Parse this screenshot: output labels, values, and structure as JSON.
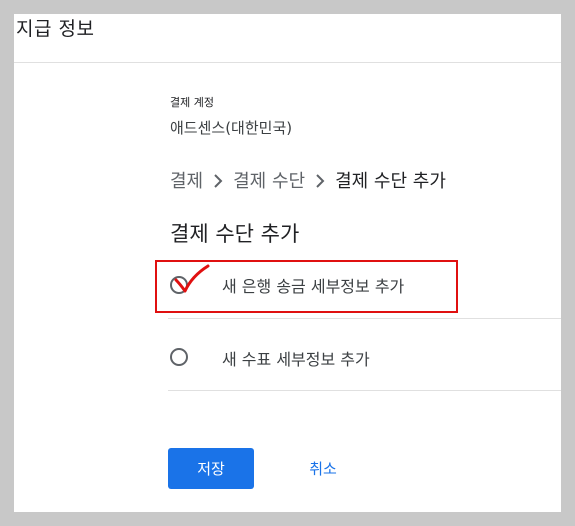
{
  "header": {
    "title": "지급 정보"
  },
  "account": {
    "label": "결제 계정",
    "name": "애드센스(대한민국)"
  },
  "breadcrumb": {
    "items": [
      "결제",
      "결제 수단",
      "결제 수단 추가"
    ]
  },
  "section": {
    "title": "결제 수단 추가"
  },
  "options": [
    {
      "label": "새 은행 송금 세부정보 추가",
      "selected": false
    },
    {
      "label": "새 수표 세부정보 추가",
      "selected": false
    }
  ],
  "actions": {
    "save_label": "저장",
    "cancel_label": "취소"
  },
  "annotation": {
    "color": "#e01010"
  },
  "colors": {
    "primary": "#1a73e8"
  }
}
